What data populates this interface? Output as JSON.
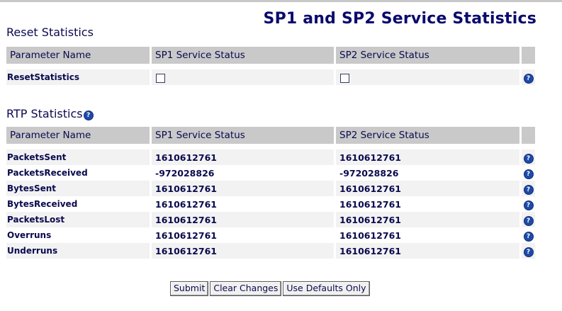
{
  "page": {
    "title": "SP1 and SP2 Service Statistics"
  },
  "reset_section": {
    "heading": "Reset Statistics",
    "columns": [
      "Parameter Name",
      "SP1 Service Status",
      "SP2 Service Status"
    ],
    "rows": [
      {
        "name": "ResetStatistics",
        "sp1_checked": false,
        "sp2_checked": false,
        "help_icon": "help-icon"
      }
    ]
  },
  "rtp_section": {
    "heading": "RTP Statistics",
    "heading_icon": "help-icon",
    "columns": [
      "Parameter Name",
      "SP1 Service Status",
      "SP2 Service Status"
    ],
    "rows": [
      {
        "name": "PacketsSent",
        "sp1": "1610612761",
        "sp2": "1610612761"
      },
      {
        "name": "PacketsReceived",
        "sp1": "-972028826",
        "sp2": "-972028826"
      },
      {
        "name": "BytesSent",
        "sp1": "1610612761",
        "sp2": "1610612761"
      },
      {
        "name": "BytesReceived",
        "sp1": "1610612761",
        "sp2": "1610612761"
      },
      {
        "name": "PacketsLost",
        "sp1": "1610612761",
        "sp2": "1610612761"
      },
      {
        "name": "Overruns",
        "sp1": "1610612761",
        "sp2": "1610612761"
      },
      {
        "name": "Underruns",
        "sp1": "1610612761",
        "sp2": "1610612761"
      }
    ]
  },
  "buttons": {
    "submit": "Submit",
    "clear": "Clear Changes",
    "defaults": "Use Defaults Only"
  },
  "icons": {
    "help": "help-icon",
    "help_glyph": "?"
  },
  "colors": {
    "title": "#0a0a6e",
    "header_bg": "#c9c9c9",
    "row_alt_bg": "#f2f2f2",
    "help_icon": "#1f4aa8"
  }
}
